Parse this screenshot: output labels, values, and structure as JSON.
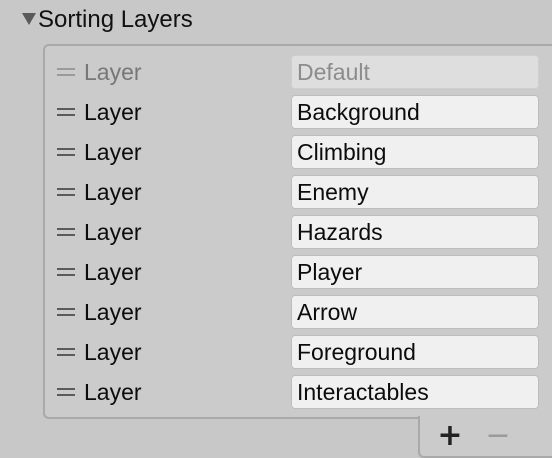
{
  "header": {
    "title": "Sorting Layers"
  },
  "layers": [
    {
      "label": "Layer",
      "name": "Default",
      "disabled": true
    },
    {
      "label": "Layer",
      "name": "Background",
      "disabled": false
    },
    {
      "label": "Layer",
      "name": "Climbing",
      "disabled": false
    },
    {
      "label": "Layer",
      "name": "Enemy",
      "disabled": false
    },
    {
      "label": "Layer",
      "name": "Hazards",
      "disabled": false
    },
    {
      "label": "Layer",
      "name": "Player",
      "disabled": false
    },
    {
      "label": "Layer",
      "name": "Arrow",
      "disabled": false
    },
    {
      "label": "Layer",
      "name": "Foreground",
      "disabled": false
    },
    {
      "label": "Layer",
      "name": "Interactables",
      "disabled": false
    }
  ],
  "footer": {
    "add_label": "+",
    "remove_label": "−"
  },
  "icons": {
    "foldout": "triangle-down-icon",
    "drag": "drag-handle-icon"
  }
}
